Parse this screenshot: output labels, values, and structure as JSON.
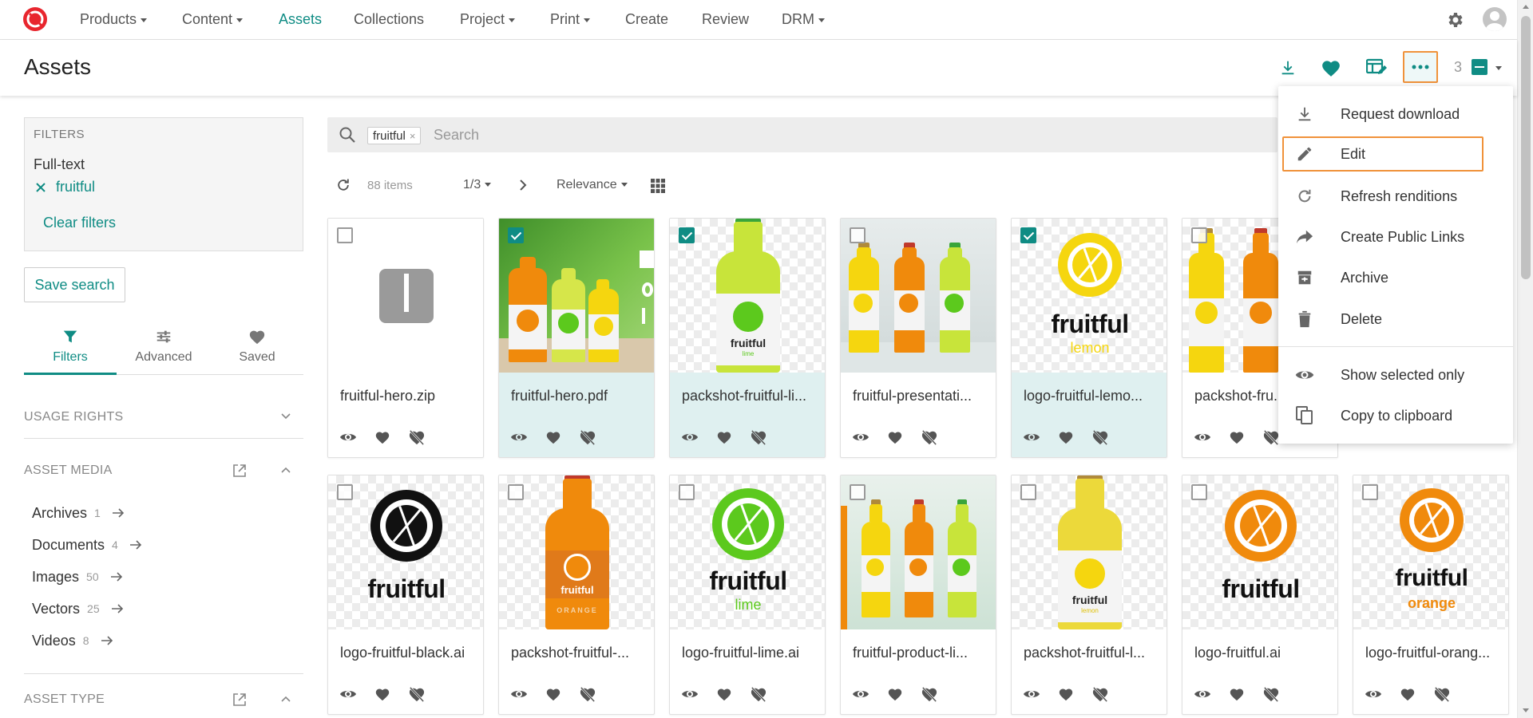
{
  "nav": {
    "items": [
      {
        "label": "Products",
        "caret": true
      },
      {
        "label": "Content",
        "caret": true
      },
      {
        "label": "Assets",
        "caret": false,
        "active": true
      },
      {
        "label": "Collections",
        "caret": false
      },
      {
        "label": "Project",
        "caret": true
      },
      {
        "label": "Print",
        "caret": true
      },
      {
        "label": "Create",
        "caret": false
      },
      {
        "label": "Review",
        "caret": false
      },
      {
        "label": "DRM",
        "caret": true
      }
    ],
    "icons": [
      "logo-icon",
      "gear-icon",
      "user-avatar-icon"
    ]
  },
  "header": {
    "title": "Assets",
    "selected_count": "3",
    "icons": [
      "download-icon",
      "heart-icon",
      "table-edit-icon",
      "more-icon"
    ]
  },
  "filters": {
    "heading": "FILTERS",
    "fulltext_label": "Full-text",
    "active_term": "fruitful",
    "clear_label": "Clear filters"
  },
  "save_search_label": "Save search",
  "sidebar_tabs": [
    {
      "label": "Filters",
      "icon": "funnel-icon",
      "active": true
    },
    {
      "label": "Advanced",
      "icon": "sliders-icon",
      "active": false
    },
    {
      "label": "Saved",
      "icon": "heart-icon",
      "active": false
    }
  ],
  "sections": {
    "usage_rights": "USAGE RIGHTS",
    "asset_media": "ASSET MEDIA",
    "asset_type": "ASSET TYPE"
  },
  "media_types": [
    {
      "label": "Archives",
      "count": "1"
    },
    {
      "label": "Documents",
      "count": "4"
    },
    {
      "label": "Images",
      "count": "50"
    },
    {
      "label": "Vectors",
      "count": "25"
    },
    {
      "label": "Videos",
      "count": "8"
    }
  ],
  "search": {
    "chip": "fruitful",
    "placeholder": "Search"
  },
  "toolbar": {
    "items_count": "88 items",
    "page": "1/3",
    "sort": "Relevance"
  },
  "assets": [
    {
      "name": "fruitful-hero.zip",
      "selected": false,
      "thumb": "zip"
    },
    {
      "name": "fruitful-hero.pdf",
      "selected": true,
      "thumb": "hero"
    },
    {
      "name": "packshot-fruitful-li...",
      "selected": true,
      "thumb": "bottle-lime"
    },
    {
      "name": "fruitful-presentati...",
      "selected": false,
      "thumb": "three-bottles"
    },
    {
      "name": "logo-fruitful-lemo...",
      "selected": true,
      "thumb": "logo-lemon"
    },
    {
      "name": "packshot-fru...",
      "selected": false,
      "thumb": "two-bottles"
    },
    {
      "name": "logo-fruitful-black.ai",
      "selected": false,
      "thumb": "logo-black"
    },
    {
      "name": "packshot-fruitful-...",
      "selected": false,
      "thumb": "bottle-orange"
    },
    {
      "name": "logo-fruitful-lime.ai",
      "selected": false,
      "thumb": "logo-lime"
    },
    {
      "name": "fruitful-product-li...",
      "selected": false,
      "thumb": "three-bottles-green"
    },
    {
      "name": "packshot-fruitful-l...",
      "selected": false,
      "thumb": "bottle-lemon"
    },
    {
      "name": "logo-fruitful.ai",
      "selected": false,
      "thumb": "logo-orange"
    },
    {
      "name": "logo-fruitful-orang...",
      "selected": false,
      "thumb": "logo-orange-sub"
    }
  ],
  "thumb_text": {
    "brand": "fruitful",
    "lemon": "lemon",
    "lime": "lime",
    "orange": "orange",
    "orange_upper": "ORANGE"
  },
  "dropdown": [
    {
      "label": "Request download",
      "icon": "download-icon"
    },
    {
      "label": "Edit",
      "icon": "pencil-icon",
      "highlighted": true
    },
    {
      "label": "Refresh renditions",
      "icon": "refresh-icon"
    },
    {
      "label": "Create Public Links",
      "icon": "share-icon"
    },
    {
      "label": "Archive",
      "icon": "archive-icon"
    },
    {
      "label": "Delete",
      "icon": "trash-icon"
    },
    {
      "label": "Show selected only",
      "icon": "eye-icon"
    },
    {
      "label": "Copy to clipboard",
      "icon": "copy-icon"
    }
  ],
  "colors": {
    "accent": "#0f8c84",
    "highlight_border": "#f0923a",
    "lemon": "#f5d60f",
    "lime": "#5cc91d",
    "orange": "#f08a0c"
  }
}
